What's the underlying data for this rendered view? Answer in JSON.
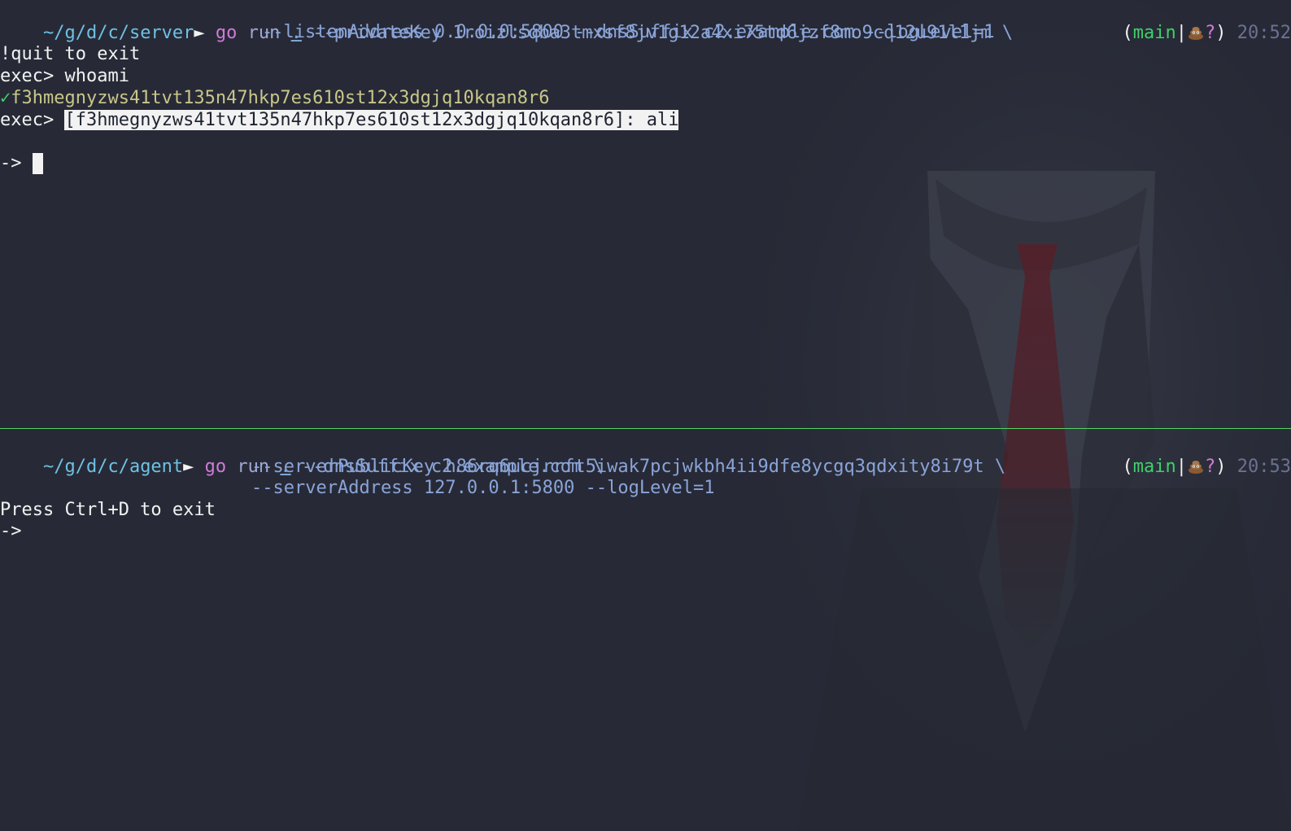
{
  "colors": {
    "background": "#272a36",
    "path": "#6ec1e4",
    "go": "#d17ad8",
    "green": "#3fd06a",
    "hash": "#c9c689",
    "divider": "#56d364"
  },
  "server_pane": {
    "prompt_path": "~/g/d/c/server",
    "prompt_arrow": "►",
    "cmd_go": "go",
    "cmd_run": "run",
    "cmd_dot": ".",
    "cmd_args_1": "--privateKey 1roizlsqba3tmxsf8jv1g12a4xi75td6jzf8mo9cq12u91l1jm \\",
    "cmd_args_2": "--listenAddress 0.0.0.0:5800 --dnsSuffix c2.example.com --logLevel=1",
    "status_open": "(",
    "status_branch": "main",
    "status_sep": "|",
    "status_icon": "pile-of-poo-icon",
    "status_q": "?",
    "status_close": ")",
    "time": "20:52",
    "quit_text": "!quit to exit",
    "exec_prompt_1": "exec> ",
    "exec_cmd_1": "whoami",
    "check_glyph": "✓",
    "agent_id": "f3hmegnyzws41tvt135n47hkp7es610st12x3dgjq10kqan8r6",
    "exec_prompt_2": "exec> ",
    "selected_text": "[f3hmegnyzws41tvt135n47hkp7es610st12x3dgjq10kqan8r6]: ali",
    "input_prompt": "-> "
  },
  "agent_pane": {
    "prompt_path": "~/g/d/c/agent",
    "prompt_arrow": "►",
    "cmd_go": "go",
    "cmd_run": "run",
    "cmd_dot": ".",
    "cmd_args_1": "--dnsSuffix c2.example.com \\",
    "cmd_args_2": "--serverPublicKey h86rq6ucjrrft5iwak7pcjwkbh4ii9dfe8ycgq3qdxity8i79t \\",
    "cmd_args_3": "--serverAddress 127.0.0.1:5800 --logLevel=1",
    "status_open": "(",
    "status_branch": "main",
    "status_sep": "|",
    "status_icon": "pile-of-poo-icon",
    "status_q": "?",
    "status_close": ")",
    "time": "20:53",
    "exit_text": "Press Ctrl+D to exit",
    "input_prompt": "->"
  }
}
